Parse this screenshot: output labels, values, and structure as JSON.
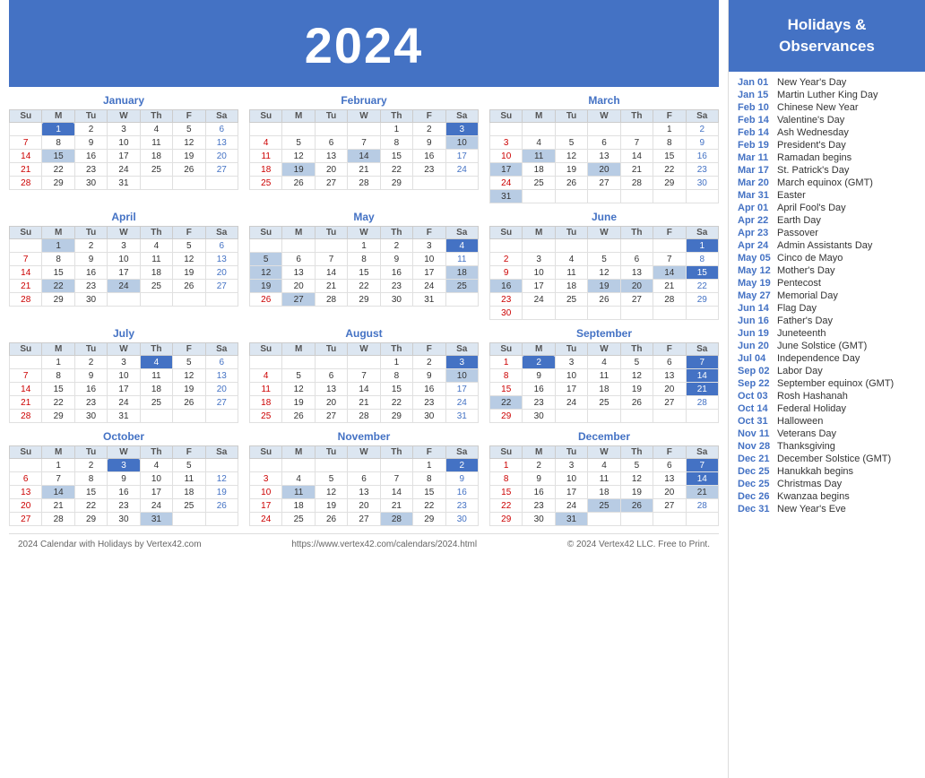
{
  "header": {
    "year": "2024"
  },
  "sidebar": {
    "title": "Holidays &\nObservances",
    "holidays": [
      {
        "date": "Jan 01",
        "name": "New Year's Day"
      },
      {
        "date": "Jan 15",
        "name": "Martin Luther King Day"
      },
      {
        "date": "Feb 10",
        "name": "Chinese New Year"
      },
      {
        "date": "Feb 14",
        "name": "Valentine's Day"
      },
      {
        "date": "Feb 14",
        "name": "Ash Wednesday"
      },
      {
        "date": "Feb 19",
        "name": "President's Day"
      },
      {
        "date": "Mar 11",
        "name": "Ramadan begins"
      },
      {
        "date": "Mar 17",
        "name": "St. Patrick's Day"
      },
      {
        "date": "Mar 20",
        "name": "March equinox (GMT)"
      },
      {
        "date": "Mar 31",
        "name": "Easter"
      },
      {
        "date": "Apr 01",
        "name": "April Fool's Day"
      },
      {
        "date": "Apr 22",
        "name": "Earth Day"
      },
      {
        "date": "Apr 23",
        "name": "Passover"
      },
      {
        "date": "Apr 24",
        "name": "Admin Assistants Day"
      },
      {
        "date": "May 05",
        "name": "Cinco de Mayo"
      },
      {
        "date": "May 12",
        "name": "Mother's Day"
      },
      {
        "date": "May 19",
        "name": "Pentecost"
      },
      {
        "date": "May 27",
        "name": "Memorial Day"
      },
      {
        "date": "Jun 14",
        "name": "Flag Day"
      },
      {
        "date": "Jun 16",
        "name": "Father's Day"
      },
      {
        "date": "Jun 19",
        "name": "Juneteenth"
      },
      {
        "date": "Jun 20",
        "name": "June Solstice (GMT)"
      },
      {
        "date": "Jul 04",
        "name": "Independence Day"
      },
      {
        "date": "Sep 02",
        "name": "Labor Day"
      },
      {
        "date": "Sep 22",
        "name": "September equinox (GMT)"
      },
      {
        "date": "Oct 03",
        "name": "Rosh Hashanah"
      },
      {
        "date": "Oct 14",
        "name": "Federal Holiday"
      },
      {
        "date": "Oct 31",
        "name": "Halloween"
      },
      {
        "date": "Nov 11",
        "name": "Veterans Day"
      },
      {
        "date": "Nov 28",
        "name": "Thanksgiving"
      },
      {
        "date": "Dec 21",
        "name": "December Solstice (GMT)"
      },
      {
        "date": "Dec 25",
        "name": "Hanukkah begins"
      },
      {
        "date": "Dec 25",
        "name": "Christmas Day"
      },
      {
        "date": "Dec 26",
        "name": "Kwanzaa begins"
      },
      {
        "date": "Dec 31",
        "name": "New Year's Eve"
      }
    ]
  },
  "footer": {
    "left": "2024 Calendar with Holidays by Vertex42.com",
    "center": "https://www.vertex42.com/calendars/2024.html",
    "right": "© 2024 Vertex42 LLC. Free to Print."
  },
  "months": [
    {
      "name": "January"
    },
    {
      "name": "February"
    },
    {
      "name": "March"
    },
    {
      "name": "April"
    },
    {
      "name": "May"
    },
    {
      "name": "June"
    },
    {
      "name": "July"
    },
    {
      "name": "August"
    },
    {
      "name": "September"
    },
    {
      "name": "October"
    },
    {
      "name": "November"
    },
    {
      "name": "December"
    }
  ]
}
